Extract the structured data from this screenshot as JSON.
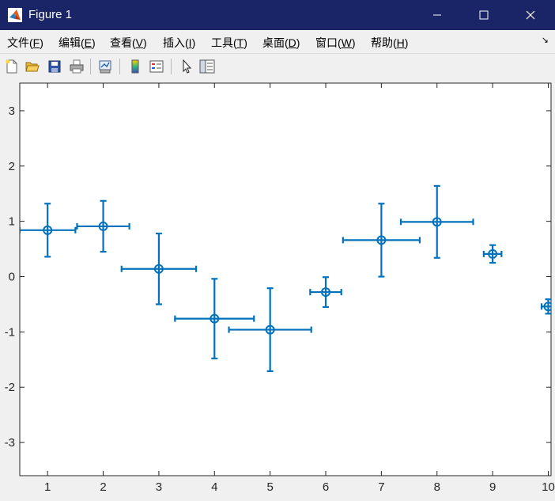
{
  "window": {
    "title": "Figure 1",
    "minimize_icon": "minimize-icon",
    "maximize_icon": "maximize-icon",
    "close_icon": "close-icon"
  },
  "menu": {
    "items": [
      {
        "label": "文件(",
        "key": "F",
        "end": ")"
      },
      {
        "label": "编辑(",
        "key": "E",
        "end": ")"
      },
      {
        "label": "查看(",
        "key": "V",
        "end": ")"
      },
      {
        "label": "插入(",
        "key": "I",
        "end": ")"
      },
      {
        "label": "工具(",
        "key": "T",
        "end": ")"
      },
      {
        "label": "桌面(",
        "key": "D",
        "end": ")"
      },
      {
        "label": "窗口(",
        "key": "W",
        "end": ")"
      },
      {
        "label": "帮助(",
        "key": "H",
        "end": ")"
      }
    ],
    "overflow_glyph": "↘"
  },
  "toolbar": {
    "icons": [
      "new-figure-icon",
      "open-file-icon",
      "save-icon",
      "print-icon",
      "link-plot-icon",
      "colorbar-icon",
      "legend-icon",
      "pointer-icon",
      "property-inspector-icon"
    ]
  },
  "colors": {
    "series": "#0072bd",
    "titlebar": "#192567",
    "axes_bg": "#ffffff"
  },
  "chart_data": {
    "type": "scatter",
    "marker": "circle",
    "error_bars": "both",
    "title": "",
    "xlabel": "",
    "ylabel": "",
    "xlim": [
      0.5,
      10.05
    ],
    "ylim": [
      -3.6,
      3.5
    ],
    "xticks": [
      1,
      2,
      3,
      4,
      5,
      6,
      7,
      8,
      9,
      10
    ],
    "yticks": [
      -3,
      -2,
      -1,
      0,
      1,
      2,
      3
    ],
    "grid": false,
    "series": [
      {
        "x": [
          1,
          2,
          3,
          4,
          5,
          6,
          7,
          8,
          9,
          10
        ],
        "y": [
          0.84,
          0.91,
          0.14,
          -0.76,
          -0.96,
          -0.28,
          0.66,
          0.99,
          0.41,
          -0.54
        ],
        "y_neg": [
          0.48,
          0.46,
          0.64,
          0.72,
          0.75,
          0.27,
          0.66,
          0.65,
          0.16,
          0.13
        ],
        "y_pos": [
          0.48,
          0.46,
          0.64,
          0.72,
          0.75,
          0.27,
          0.66,
          0.65,
          0.16,
          0.13
        ],
        "x_neg": [
          0.5,
          0.47,
          0.67,
          0.71,
          0.74,
          0.28,
          0.69,
          0.65,
          0.16,
          0.12
        ],
        "x_pos": [
          0.5,
          0.47,
          0.67,
          0.71,
          0.74,
          0.28,
          0.69,
          0.65,
          0.16,
          0.12
        ]
      }
    ]
  }
}
